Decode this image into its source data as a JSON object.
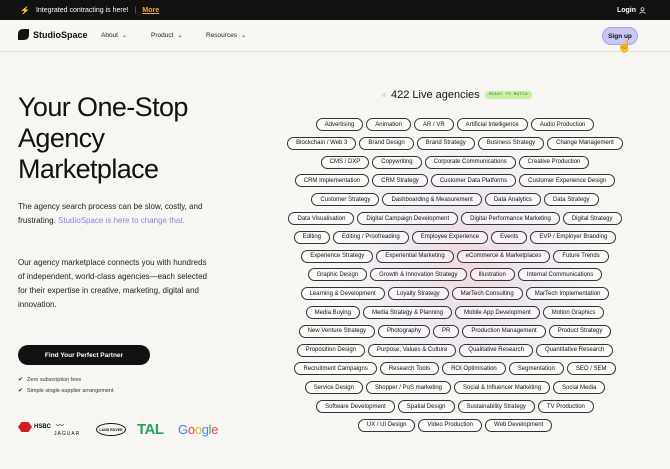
{
  "announcement": {
    "text": "Integrated contracting is here!",
    "separator": "|",
    "link": "More",
    "login": "Login"
  },
  "nav": {
    "brand": "StudioSpace",
    "items": [
      {
        "label": "About"
      },
      {
        "label": "Product"
      },
      {
        "label": "Resources"
      }
    ],
    "signup": "Sign up"
  },
  "hero": {
    "title": "Your One-Stop Agency Marketplace",
    "intro_plain": "The agency search process can be slow, costly, and frustrating. ",
    "intro_highlight": "StudioSpace is here to change that.",
    "paragraph": "Our agency marketplace connects you with hundreds of independent, world-class agencies—each selected for their expertise in creative, marketing, digital and innovation.",
    "cta": "Find Your Perfect Partner",
    "features": [
      "Zero subscription fees",
      "Simple single-supplier arrangement"
    ]
  },
  "logos": {
    "hsbc": "HSBC",
    "jaguar": "JAGUAR",
    "landrover": "LAND ROVER",
    "tal": "TAL",
    "google": "Google"
  },
  "live": {
    "count_text": "422 Live agencies",
    "badge": "READY TO MATCH"
  },
  "tags": [
    [
      "Advertising",
      "Animation",
      "AR / VR",
      "Artificial Intelligence",
      "Audio Production"
    ],
    [
      "Blockchain / Web 3",
      "Brand Design",
      "Brand Strategy",
      "Business Strategy",
      "Change Management"
    ],
    [
      "CMS / DXP",
      "Copywriting",
      "Corporate Communications",
      "Creative Production"
    ],
    [
      "CRM Implementation",
      "CRM Strategy",
      "Customer Data Platforms",
      "Customer Experience Design"
    ],
    [
      "Customer Strategy",
      "Dashboarding & Measurement",
      "Data Analytics",
      "Data Strategy"
    ],
    [
      "Data Visualisation",
      "Digital Campaign Development",
      "Digital Performance Marketing",
      "Digital Strategy"
    ],
    [
      "Editing",
      "Editing / Proofreading",
      "Employee Experience",
      "Events",
      "EVP / Employer Branding"
    ],
    [
      "Experience Strategy",
      "Experiential Marketing",
      "eCommerce & Marketplaces",
      "Future Trends"
    ],
    [
      "Graphic Design",
      "Growth & Innovation Strategy",
      "Illustration",
      "Internal Communications"
    ],
    [
      "Learning & Development",
      "Loyalty Strategy",
      "MarTech Consulting",
      "MarTech Implementation"
    ],
    [
      "Media Buying",
      "Media Strategy & Planning",
      "Mobile App Development",
      "Motion Graphics"
    ],
    [
      "New Venture Strategy",
      "Photography",
      "PR",
      "Production Management",
      "Product Strategy"
    ],
    [
      "Proposition Design",
      "Purpose, Values & Culture",
      "Qualitative Research",
      "Quantitative Research"
    ],
    [
      "Recruitment Campaigns",
      "Research Tools",
      "ROI Optimisation",
      "Segmentation",
      "SEO / SEM"
    ],
    [
      "Service Design",
      "Shopper / PoS marketing",
      "Social & Influencer Marketing",
      "Social Media"
    ],
    [
      "Software Development",
      "Spatial Design",
      "Sustainability Strategy",
      "TV Production"
    ],
    [
      "UX / UI Design",
      "Video Production",
      "Web Development"
    ]
  ]
}
